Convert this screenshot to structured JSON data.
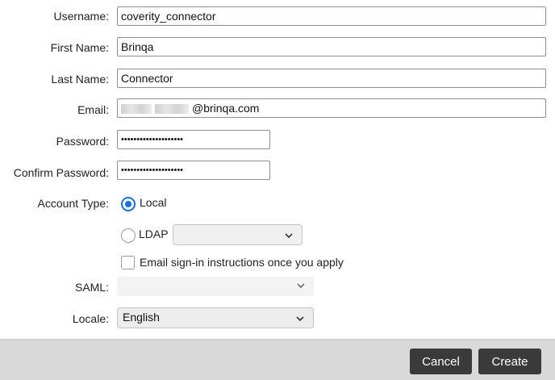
{
  "form": {
    "username": {
      "label": "Username:",
      "value": "coverity_connector"
    },
    "first_name": {
      "label": "First Name:",
      "value": "Brinqa"
    },
    "last_name": {
      "label": "Last Name:",
      "value": "Connector"
    },
    "email": {
      "label": "Email:",
      "value_visible": "@brinqa.com"
    },
    "password": {
      "label": "Password:",
      "value": "••••••••••••••••••••"
    },
    "confirm_password": {
      "label": "Confirm Password:",
      "value": "••••••••••••••••••••"
    },
    "account_type": {
      "label": "Account Type:",
      "options": [
        {
          "label": "Local",
          "selected": true
        },
        {
          "label": "LDAP",
          "selected": false
        }
      ],
      "ldap_select_value": ""
    },
    "email_instructions": {
      "label": "Email sign-in instructions once you apply",
      "checked": false
    },
    "saml": {
      "label": "SAML:",
      "value": ""
    },
    "locale": {
      "label": "Locale:",
      "value": "English"
    }
  },
  "footer": {
    "cancel_label": "Cancel",
    "create_label": "Create"
  },
  "colors": {
    "accent": "#1a6fe0",
    "button_bg": "#3a3a3a",
    "footer_bg": "#d9d9d9"
  },
  "icons": [
    "chevron-down-icon"
  ]
}
